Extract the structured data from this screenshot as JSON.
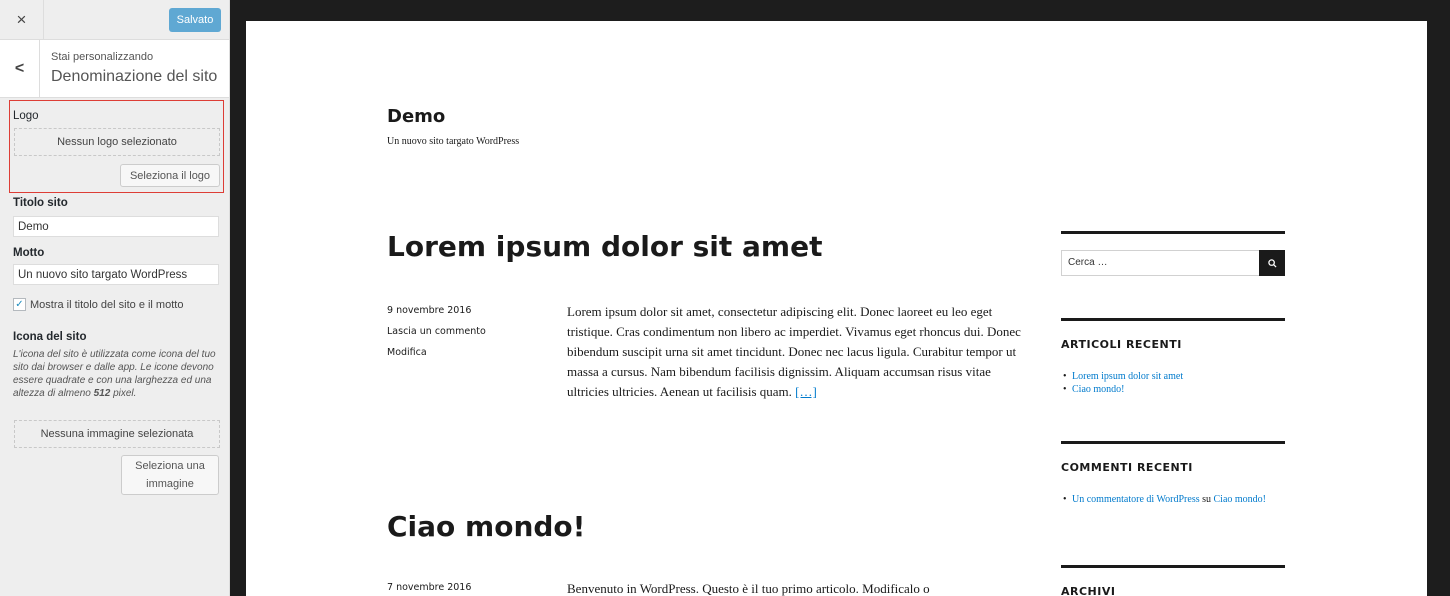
{
  "customizer": {
    "close_icon": "×",
    "save_label": "Salvato",
    "back_icon": "<",
    "section_subtitle": "Stai personalizzando",
    "section_title": "Denominazione del sito",
    "logo": {
      "label": "Logo",
      "placeholder": "Nessun logo selezionato",
      "button": "Seleziona il logo"
    },
    "site_title": {
      "label": "Titolo sito",
      "value": "Demo"
    },
    "tagline": {
      "label": "Motto",
      "value": "Un nuovo sito targato WordPress"
    },
    "display_checkbox": {
      "checked": true,
      "label": "Mostra il titolo del sito e il motto"
    },
    "site_icon": {
      "label": "Icona del sito",
      "description_part1": "L'icona del sito è utilizzata come icona del tuo sito dai browser e dalle app. Le icone devono essere quadrate e con una larghezza ed una altezza di almeno ",
      "description_bold": "512",
      "description_part2": " pixel.",
      "placeholder": "Nessuna immagine selezionata",
      "button_line1": "Seleziona una",
      "button_line2": "immagine"
    },
    "colors": {
      "save_button": "#5fa8d3",
      "highlight_border": "#dd3d36"
    }
  },
  "preview": {
    "site_title": "Demo",
    "site_description": "Un nuovo sito targato WordPress",
    "posts": [
      {
        "title": "Lorem ipsum dolor sit amet",
        "date": "9 novembre 2016",
        "comment_link": "Lascia un commento",
        "edit_link": "Modifica",
        "excerpt": "Lorem ipsum dolor sit amet, consectetur adipiscing elit. Donec laoreet eu leo eget tristique. Cras condimentum non libero ac imperdiet. Vivamus eget rhoncus dui. Donec bibendum suscipit urna sit amet tincidunt. Donec nec lacus ligula. Curabitur tempor ut massa a cursus. Nam bibendum facilisis dignissim. Aliquam accumsan risus vitae ultricies ultricies. Aenean ut facilisis quam.",
        "more": "[…]"
      },
      {
        "title": "Ciao mondo!",
        "date": "7 novembre 2016",
        "excerpt": "Benvenuto in WordPress. Questo è il tuo primo articolo. Modificalo o"
      }
    ],
    "widgets": {
      "search_placeholder": "Cerca …",
      "search_icon": "search-icon",
      "recent_posts_title": "ARTICOLI RECENTI",
      "recent_posts": [
        "Lorem ipsum dolor sit amet",
        "Ciao mondo!"
      ],
      "recent_comments_title": "COMMENTI RECENTI",
      "recent_comment": {
        "author": "Un commentatore di WordPress",
        "on": "su",
        "post": "Ciao mondo!"
      },
      "archives_title": "ARCHIVI"
    },
    "link_color": "#007acc"
  }
}
